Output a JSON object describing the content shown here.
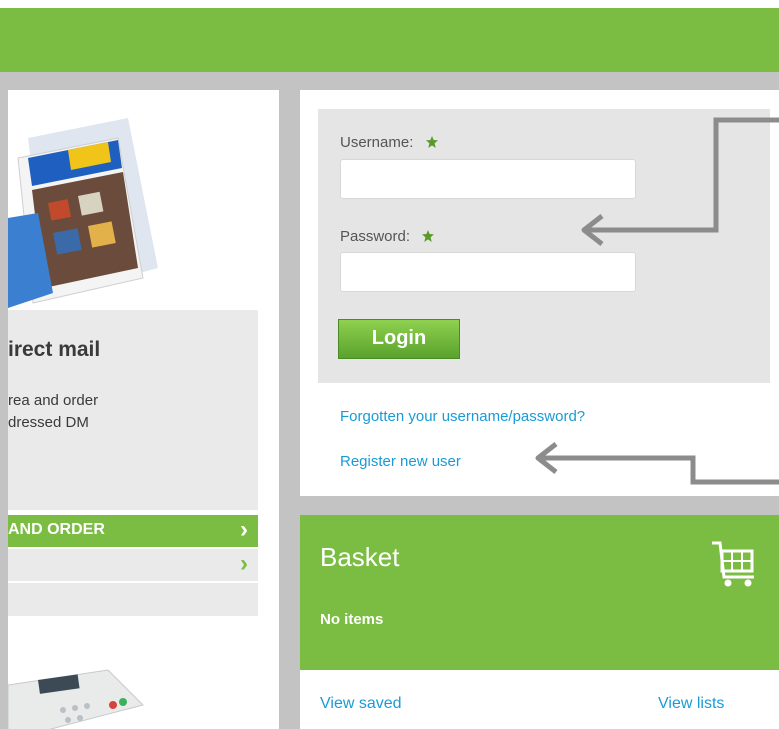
{
  "login": {
    "username_label": "Username:",
    "password_label": "Password:",
    "username_value": "",
    "password_value": "",
    "login_label": "Login",
    "forgot_link": "Forgotten your username/password?",
    "register_link": "Register new user"
  },
  "direct_mail": {
    "title": "irect mail",
    "text": "rea and order\ndressed DM"
  },
  "left_nav": {
    "item1": "AND ORDER",
    "chevron": "›"
  },
  "basket": {
    "title": "Basket",
    "empty_text": "No items",
    "view_saved": "View saved",
    "view_lists": "View lists"
  },
  "colors": {
    "brand_green": "#7bbd42",
    "link_blue": "#1a9bd6",
    "arrow_gray": "#8c8c8c"
  },
  "icons": [
    "star-icon",
    "cart-icon",
    "chevron-right-icon",
    "arrow-icon"
  ]
}
